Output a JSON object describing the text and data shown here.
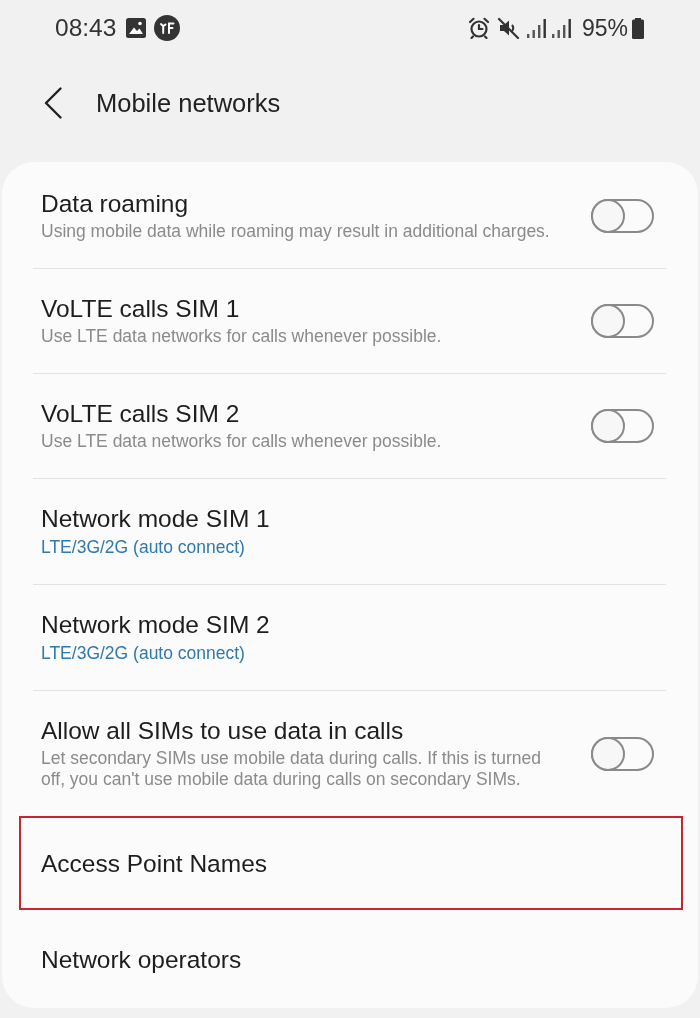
{
  "status_bar": {
    "time": "08:43",
    "battery": "95%"
  },
  "header": {
    "title": "Mobile networks"
  },
  "items": [
    {
      "kind": "toggle",
      "title": "Data roaming",
      "description": "Using mobile data while roaming may result in additional charges.",
      "on": false,
      "highlighted": false
    },
    {
      "kind": "toggle",
      "title": "VoLTE calls SIM 1",
      "description": "Use LTE data networks for calls whenever possible.",
      "on": false,
      "highlighted": false
    },
    {
      "kind": "toggle",
      "title": "VoLTE calls SIM 2",
      "description": "Use LTE data networks for calls whenever possible.",
      "on": false,
      "highlighted": false
    },
    {
      "kind": "choice",
      "title": "Network mode SIM 1",
      "value": "LTE/3G/2G (auto connect)",
      "highlighted": false
    },
    {
      "kind": "choice",
      "title": "Network mode SIM 2",
      "value": "LTE/3G/2G (auto connect)",
      "highlighted": false
    },
    {
      "kind": "toggle",
      "title": "Allow all SIMs to use data in calls",
      "description": "Let secondary SIMs use mobile data during calls. If this is turned off, you can't use mobile data during calls on secondary SIMs.",
      "on": false,
      "highlighted": false
    },
    {
      "kind": "link",
      "title": "Access Point Names",
      "highlighted": true
    },
    {
      "kind": "link",
      "title": "Network operators",
      "highlighted": false
    }
  ]
}
